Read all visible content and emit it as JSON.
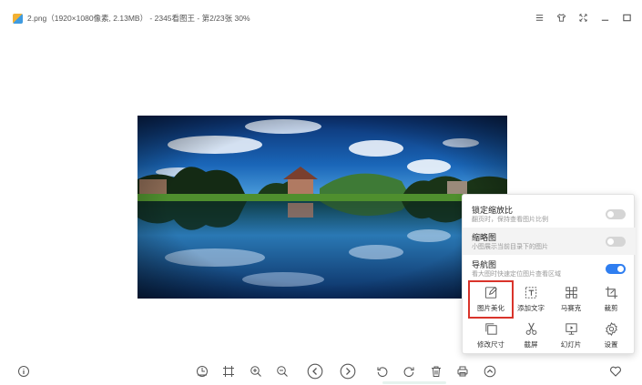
{
  "window": {
    "title": "2.png（1920×1080像素, 2.13MB） - 2345看图王 - 第2/23张 30%",
    "controls": [
      "menu-icon",
      "skin-icon",
      "fullscreen-icon",
      "minimize-icon",
      "maximize-icon"
    ]
  },
  "popup": {
    "options": [
      {
        "title": "锁定缩放比",
        "desc": "翻页时，保持查看图片比例",
        "enabled": false
      },
      {
        "title": "缩略图",
        "desc": "小图展示当前目录下的图片",
        "enabled": false
      },
      {
        "title": "导航图",
        "desc": "看大图时快速定位图片查看区域",
        "enabled": true
      }
    ],
    "tools": [
      {
        "label": "图片美化",
        "icon": "edit-icon"
      },
      {
        "label": "添加文字",
        "icon": "add-text-icon"
      },
      {
        "label": "马赛克",
        "icon": "mosaic-icon"
      },
      {
        "label": "裁剪",
        "icon": "crop-icon"
      },
      {
        "label": "修改尺寸",
        "icon": "resize-icon"
      },
      {
        "label": "截屏",
        "icon": "scissors-icon"
      },
      {
        "label": "幻灯片",
        "icon": "slideshow-icon"
      },
      {
        "label": "设置",
        "icon": "settings-icon"
      }
    ]
  },
  "toolbar": {
    "left": [
      "info-icon"
    ],
    "center": [
      "original-size-icon",
      "fit-window-icon",
      "zoom-in-icon",
      "zoom-out-icon",
      "previous-icon",
      "next-icon",
      "rotate-left-icon",
      "rotate-right-icon",
      "delete-icon",
      "print-icon",
      "more-icon"
    ],
    "right": [
      "favorite-icon"
    ]
  },
  "colors": {
    "accent": "#2f7ef0",
    "highlight": "#d9342b"
  }
}
